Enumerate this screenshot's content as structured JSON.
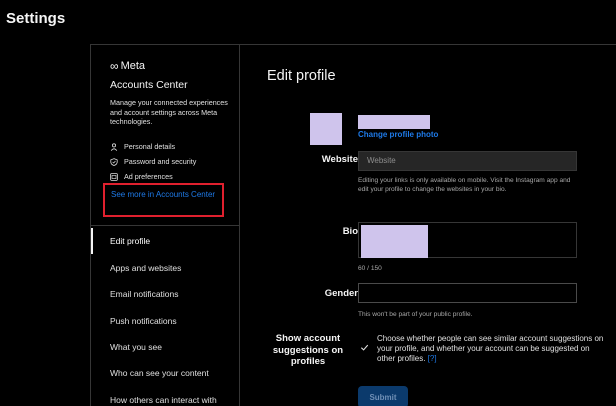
{
  "page": {
    "title": "Settings"
  },
  "sidebar": {
    "brand": "Meta",
    "accounts_center_title": "Accounts Center",
    "accounts_center_desc": "Manage your connected experiences and account settings across Meta technologies.",
    "ac_items": [
      {
        "label": "Personal details",
        "icon": "person-icon"
      },
      {
        "label": "Password and security",
        "icon": "shield-icon"
      },
      {
        "label": "Ad preferences",
        "icon": "ad-icon"
      }
    ],
    "see_more": "See more in Accounts Center",
    "nav": [
      {
        "label": "Edit profile",
        "active": true
      },
      {
        "label": "Apps and websites"
      },
      {
        "label": "Email notifications"
      },
      {
        "label": "Push notifications"
      },
      {
        "label": "What you see"
      },
      {
        "label": "Who can see your content"
      },
      {
        "label": "How others can interact with"
      }
    ]
  },
  "main": {
    "title": "Edit profile",
    "change_photo": "Change profile photo",
    "website": {
      "label": "Website",
      "placeholder": "Website",
      "help": "Editing your links is only available on mobile. Visit the Instagram app and edit your profile to change the websites in your bio."
    },
    "bio": {
      "label": "Bio",
      "count": "60 / 150"
    },
    "gender": {
      "label": "Gender",
      "help": "This won't be part of your public profile."
    },
    "suggestions": {
      "label": "Show account suggestions on profiles",
      "text": "Choose whether people can see similar account suggestions on your profile, and whether your account can be suggested on other profiles.",
      "help_link": "[?]",
      "checked": true
    },
    "submit": "Submit"
  },
  "colors": {
    "accent": "#1e7ae8",
    "highlight_box": "#e0202e",
    "redacted": "#cfc4ec",
    "background": "#000000",
    "border": "#363636"
  }
}
